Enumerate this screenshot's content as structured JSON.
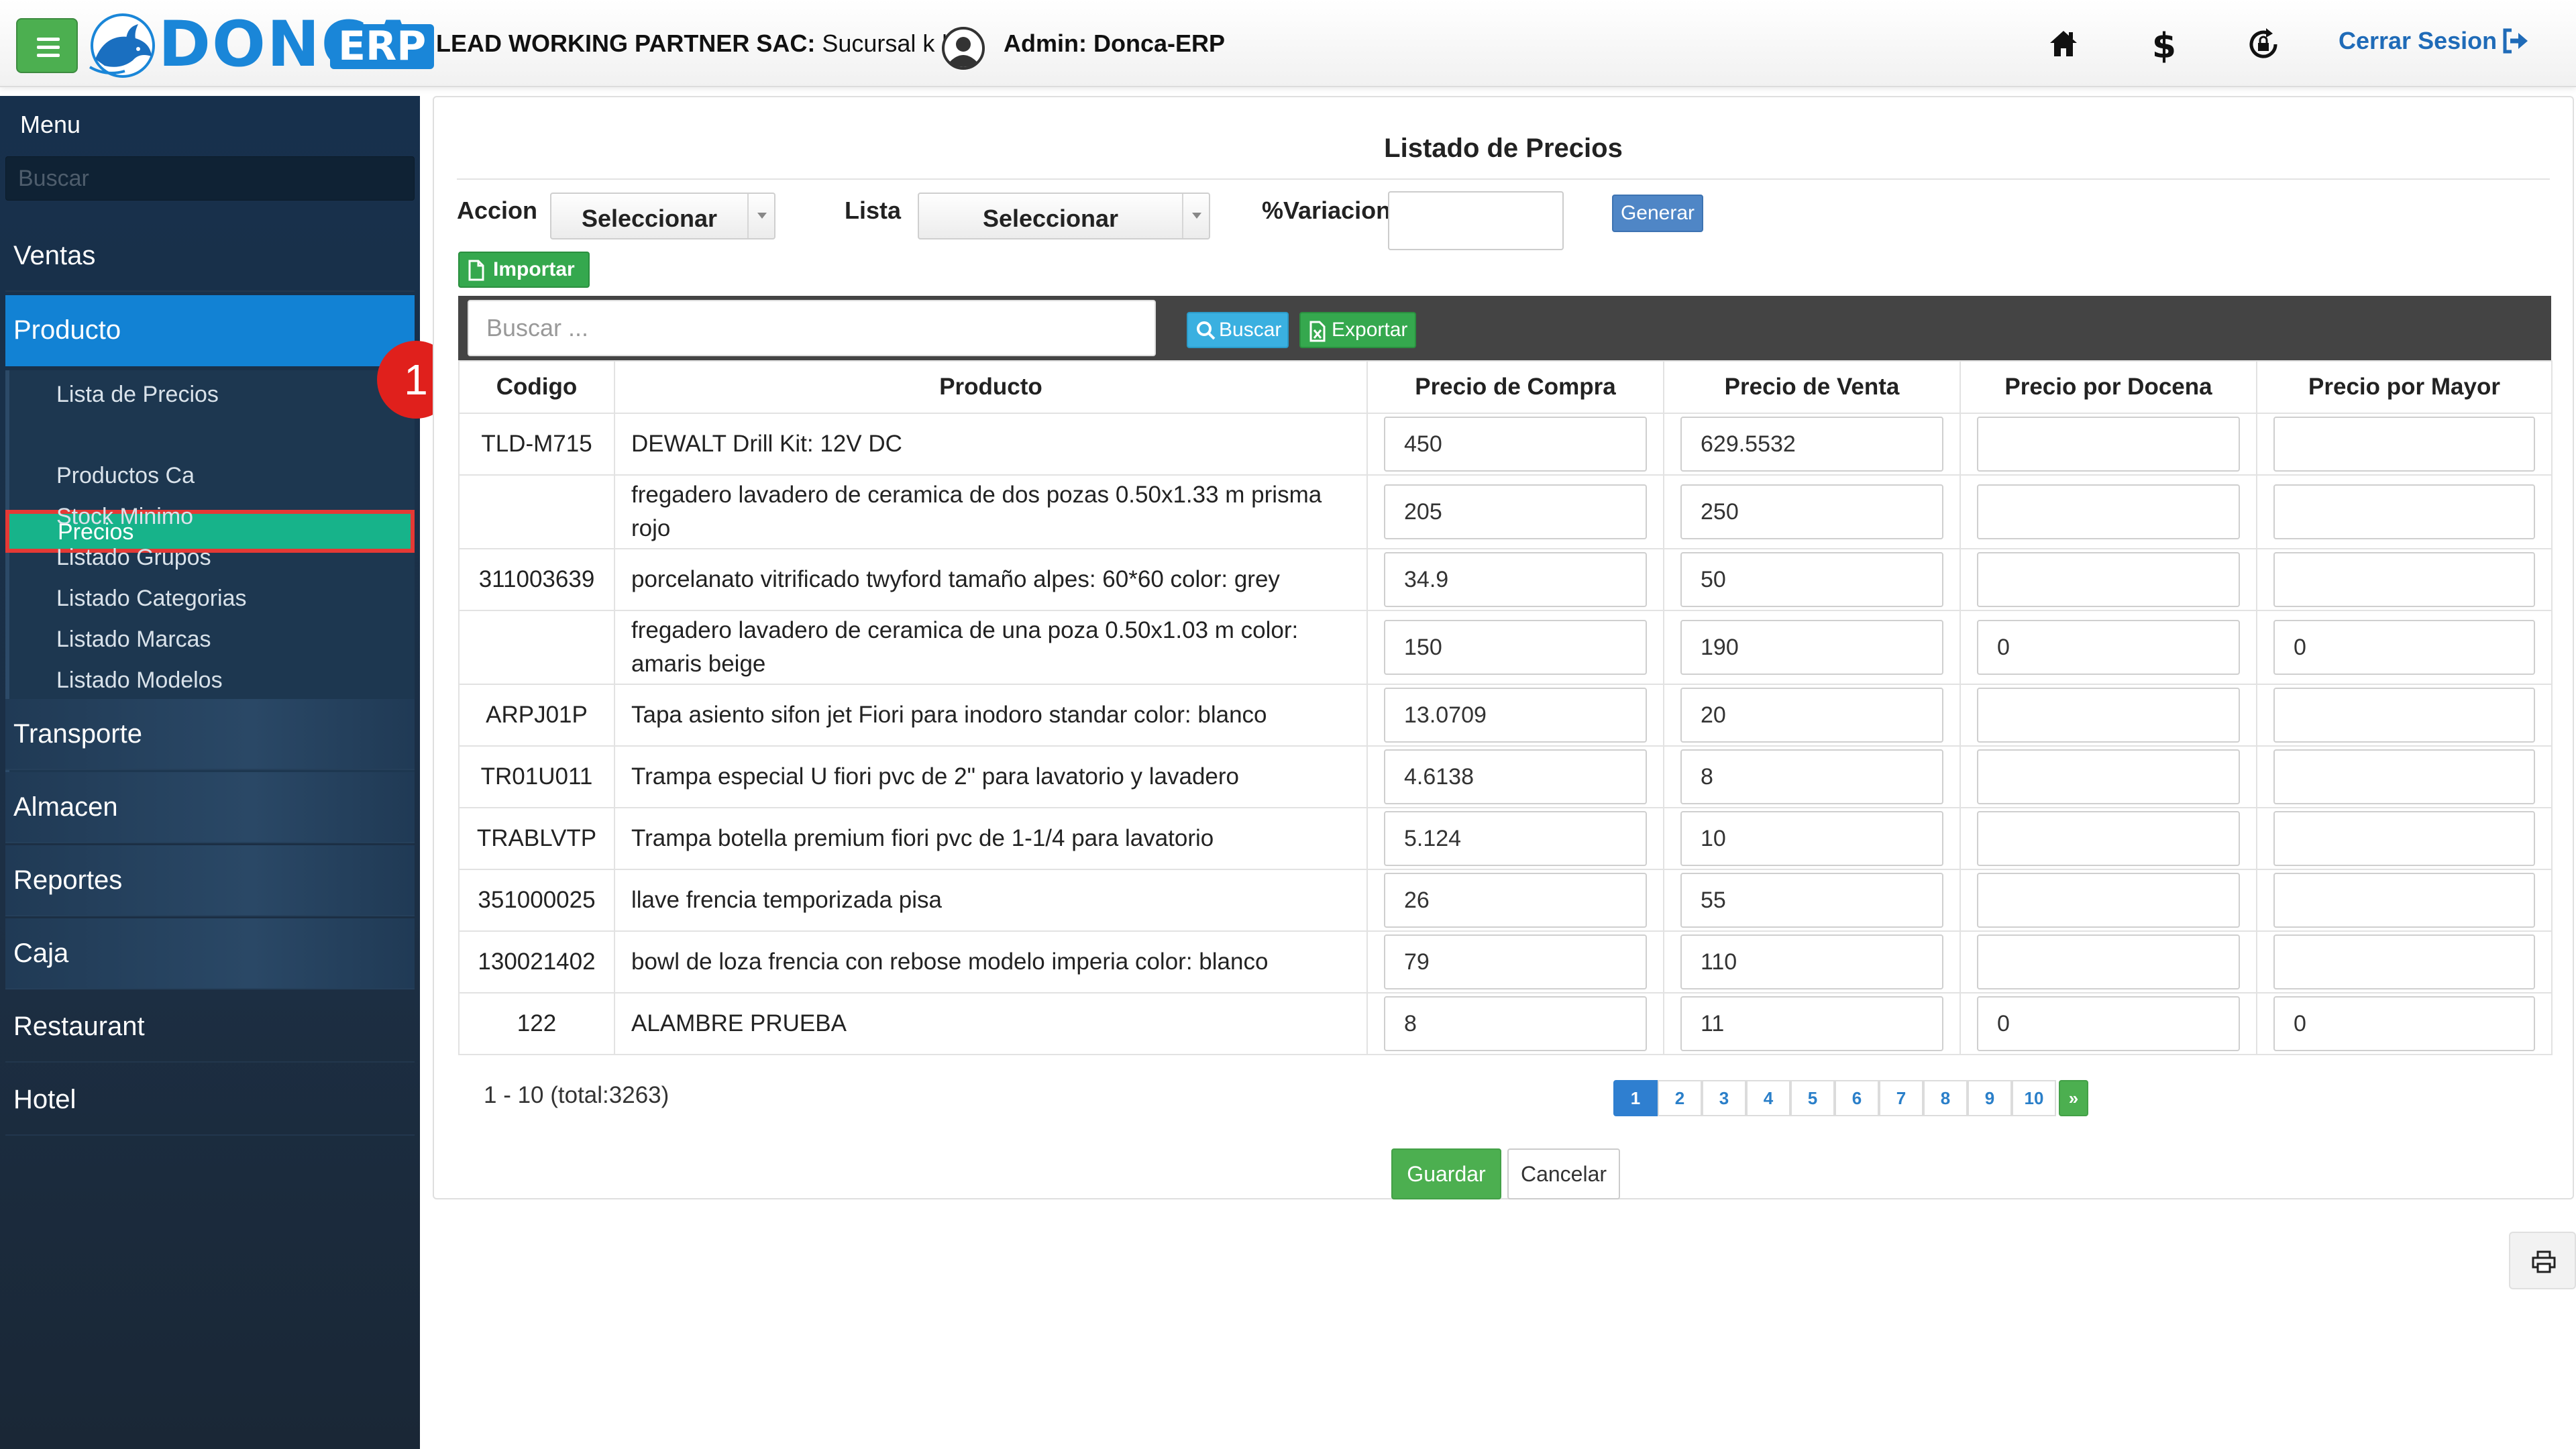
{
  "header": {
    "brand": "DONCA",
    "brand_badge": "ERP",
    "company_name": "LEAD WORKING PARTNER SAC:",
    "branch": " Sucursal k | ",
    "admin": "Admin: Donca-ERP",
    "logout_label": "Cerrar Sesion"
  },
  "sidebar": {
    "title": "Menu",
    "search_placeholder": "Buscar",
    "items": [
      {
        "label": "Ventas"
      },
      {
        "label": "Producto"
      },
      {
        "label": "Transporte"
      },
      {
        "label": "Almacen"
      },
      {
        "label": "Reportes"
      },
      {
        "label": "Caja"
      },
      {
        "label": "Restaurant"
      },
      {
        "label": "Hotel"
      }
    ],
    "submenu": [
      {
        "label": "Lista de Precios"
      },
      {
        "label": "Precios"
      },
      {
        "label": "Productos Ca"
      },
      {
        "label": "Stock Minimo"
      },
      {
        "label": "Listado Grupos"
      },
      {
        "label": "Listado Categorias"
      },
      {
        "label": "Listado Marcas"
      },
      {
        "label": "Listado Modelos"
      }
    ],
    "step_badge": "1"
  },
  "main": {
    "title": "Listado de Precios",
    "accion_label": "Accion",
    "accion_value": "Seleccionar",
    "lista_label": "Lista",
    "lista_value": "Seleccionar",
    "variacion_label": "%Variacion",
    "variacion_value": "",
    "generar_label": "Generar",
    "importar_label": "Importar",
    "search_placeholder": "Buscar ...",
    "buscar_label": "Buscar",
    "exportar_label": "Exportar",
    "columns": [
      "Codigo",
      "Producto",
      "Precio de Compra",
      "Precio de Venta",
      "Precio por Docena",
      "Precio por Mayor"
    ],
    "rows": [
      {
        "codigo": "TLD-M715",
        "producto": "DEWALT Drill Kit: 12V DC",
        "compra": "450",
        "venta": "629.5532",
        "docena": "",
        "mayor": ""
      },
      {
        "codigo": "",
        "producto": "fregadero lavadero de ceramica de dos pozas 0.50x1.33 m prisma rojo",
        "compra": "205",
        "venta": "250",
        "docena": "",
        "mayor": ""
      },
      {
        "codigo": "311003639",
        "producto": "porcelanato vitrificado twyford tamaño alpes: 60*60 color: grey",
        "compra": "34.9",
        "venta": "50",
        "docena": "",
        "mayor": ""
      },
      {
        "codigo": "",
        "producto": "fregadero lavadero de ceramica de una poza 0.50x1.03 m color: amaris beige",
        "compra": "150",
        "venta": "190",
        "docena": "0",
        "mayor": "0"
      },
      {
        "codigo": "ARPJ01P",
        "producto": "Tapa asiento sifon jet Fiori para inodoro standar color: blanco",
        "compra": "13.0709",
        "venta": "20",
        "docena": "",
        "mayor": ""
      },
      {
        "codigo": "TR01U011",
        "producto": "Trampa especial U fiori pvc de 2\" para lavatorio y lavadero",
        "compra": "4.6138",
        "venta": "8",
        "docena": "",
        "mayor": ""
      },
      {
        "codigo": "TRABLVTP",
        "producto": "Trampa botella premium fiori pvc de 1-1/4 para lavatorio",
        "compra": "5.124",
        "venta": "10",
        "docena": "",
        "mayor": ""
      },
      {
        "codigo": "351000025",
        "producto": "llave frencia temporizada pisa",
        "compra": "26",
        "venta": "55",
        "docena": "",
        "mayor": ""
      },
      {
        "codigo": "130021402",
        "producto": "bowl de loza frencia con rebose modelo imperia color: blanco",
        "compra": "79",
        "venta": "110",
        "docena": "",
        "mayor": ""
      },
      {
        "codigo": "122",
        "producto": "ALAMBRE PRUEBA",
        "compra": "8",
        "venta": "11",
        "docena": "0",
        "mayor": "0"
      }
    ],
    "pager_info": "1 - 10 (total:3263)",
    "pages": [
      "1",
      "2",
      "3",
      "4",
      "5",
      "6",
      "7",
      "8",
      "9",
      "10"
    ],
    "next_label": "»",
    "guardar_label": "Guardar",
    "cancelar_label": "Cancelar"
  },
  "colors": {
    "accent_green": "#4caf50",
    "brand_blue": "#1a86d8",
    "sidebar_active": "#1282d4",
    "submenu_selected": "#17b38a",
    "highlight_red": "#e53935"
  }
}
